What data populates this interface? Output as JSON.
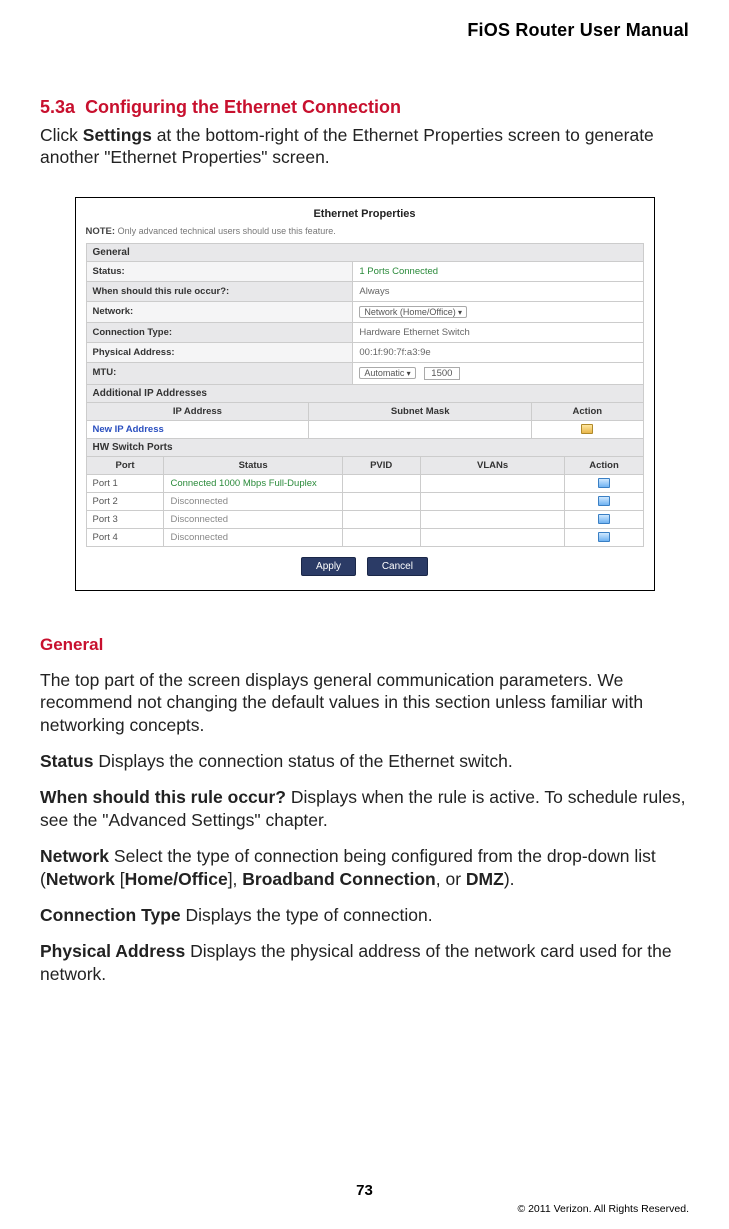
{
  "header": {
    "title": "FiOS Router User Manual"
  },
  "section": {
    "number": "5.3a",
    "title": "Configuring the Ethernet Connection",
    "intro_prefix": "Click ",
    "intro_bold": "Settings",
    "intro_suffix": " at the bottom-right of the Ethernet Properties screen to generate another \"Ethernet Properties\" screen."
  },
  "screenshot": {
    "title": "Ethernet Properties",
    "note_label": "NOTE:",
    "note_text": "Only advanced technical users should use this feature.",
    "general_header": "General",
    "rows": {
      "status_label": "Status:",
      "status_value": "1 Ports Connected",
      "when_label": "When should this rule occur?:",
      "when_value": "Always",
      "network_label": "Network:",
      "network_value": "Network (Home/Office)",
      "conn_type_label": "Connection Type:",
      "conn_type_value": "Hardware Ethernet Switch",
      "phys_label": "Physical Address:",
      "phys_value": "00:1f:90:7f:a3:9e",
      "mtu_label": "MTU:",
      "mtu_mode": "Automatic",
      "mtu_value": "1500"
    },
    "additional_ip_header": "Additional IP Addresses",
    "ip_table": {
      "headers": [
        "IP Address",
        "Subnet Mask",
        "Action"
      ],
      "new_ip_label": "New IP Address"
    },
    "hw_switch_header": "HW Switch Ports",
    "port_table": {
      "headers": [
        "Port",
        "Status",
        "PVID",
        "VLANs",
        "Action"
      ],
      "rows": [
        {
          "port": "Port 1",
          "status": "Connected 1000 Mbps Full-Duplex",
          "connected": true
        },
        {
          "port": "Port 2",
          "status": "Disconnected",
          "connected": false
        },
        {
          "port": "Port 3",
          "status": "Disconnected",
          "connected": false
        },
        {
          "port": "Port 4",
          "status": "Disconnected",
          "connected": false
        }
      ]
    },
    "buttons": {
      "apply": "Apply",
      "cancel": "Cancel"
    }
  },
  "general_section": {
    "heading": "General",
    "intro": "The top part of the screen displays general communication parameters. We recommend not changing the default values in this section unless familiar with networking concepts.",
    "defs": [
      {
        "term": "Status",
        "text": "  Displays the connection status of the Ethernet switch."
      },
      {
        "term": "When should this rule occur?",
        "text": "  Displays when the rule is active. To schedule rules, see the \"Advanced Settings\" chapter."
      }
    ],
    "network_def": {
      "term": "Network",
      "t1": "  Select the type of connection being configured from the drop-down list (",
      "b1": "Network",
      "t2": " [",
      "b2": "Home/Office",
      "t3": "], ",
      "b3": "Broadband Connection",
      "t4": ", or ",
      "b4": "DMZ",
      "t5": ")."
    },
    "defs2": [
      {
        "term": "Connection Type",
        "text": "  Displays the type of connection."
      },
      {
        "term": "Physical Address",
        "text": "  Displays the physical address of the network card used for the network."
      }
    ]
  },
  "footer": {
    "page_number": "73",
    "copyright": "© 2011 Verizon. All Rights Reserved."
  }
}
